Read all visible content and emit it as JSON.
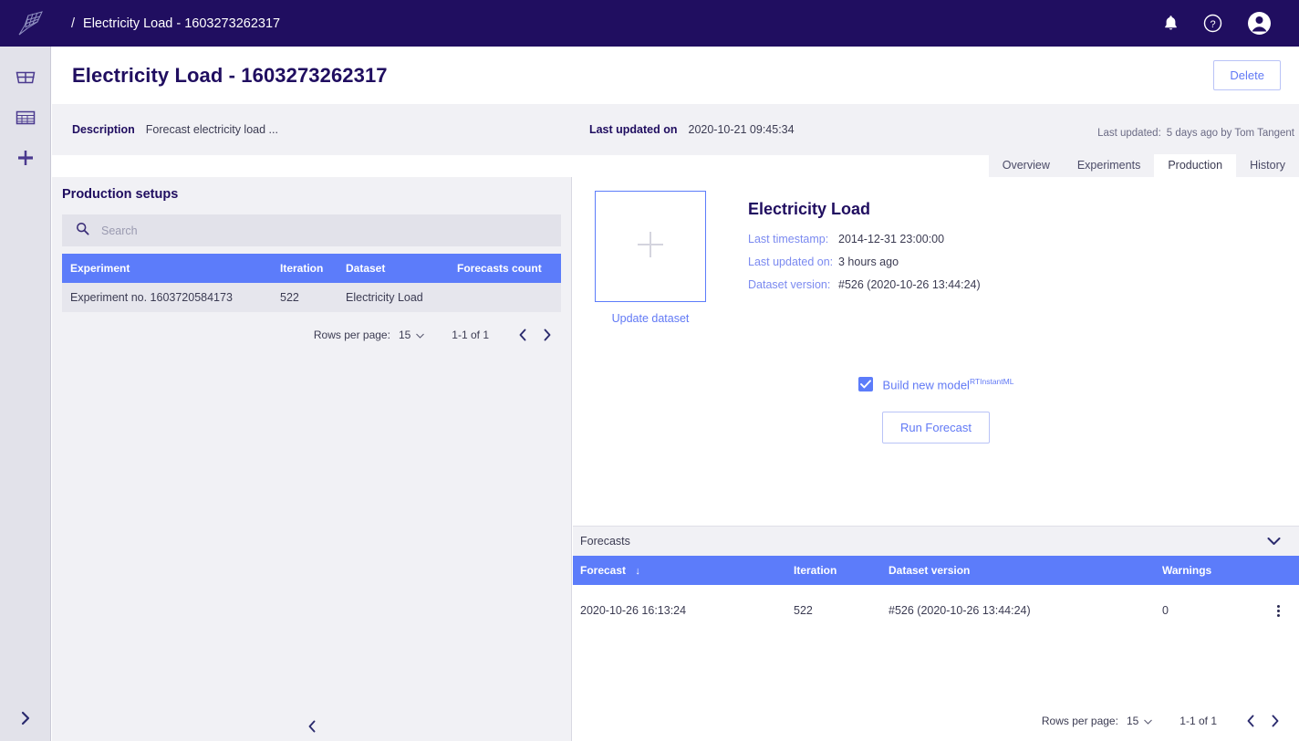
{
  "topbar": {
    "logo_icon": "net-logo-icon",
    "breadcrumb_separator": "/",
    "breadcrumb_title": "Electricity Load - 1603273262317",
    "icons": [
      {
        "name": "notifications-icon",
        "label": "bell"
      },
      {
        "name": "help-icon",
        "label": "question-circle"
      },
      {
        "name": "account-icon",
        "label": "user-avatar"
      }
    ]
  },
  "rail": {
    "items": [
      {
        "name": "dashboard-icon",
        "label": "Dashboard"
      },
      {
        "name": "datasets-table-icon",
        "label": "Datasets"
      },
      {
        "name": "add-new-icon",
        "label": "Add new"
      }
    ],
    "expand_icon": "chevron-right-icon"
  },
  "page": {
    "title": "Electricity Load - 1603273262317",
    "delete_label": "Delete"
  },
  "meta": {
    "description_label": "Description",
    "description_value": "Forecast electricity load ...",
    "last_updated_on_label": "Last updated on",
    "last_updated_on_value": "2020-10-21 09:45:34",
    "last_updated_label": "Last updated:",
    "last_updated_value": "5 days ago by Tom Tangent"
  },
  "tabs": [
    {
      "label": "Overview",
      "active": false
    },
    {
      "label": "Experiments",
      "active": false
    },
    {
      "label": "Production",
      "active": true
    },
    {
      "label": "History",
      "active": false
    }
  ],
  "left_panel": {
    "title": "Production setups",
    "search": {
      "placeholder": "Search",
      "value": "",
      "icon": "search-icon"
    },
    "table": {
      "columns": [
        "Experiment",
        "Iteration",
        "Dataset",
        "Forecasts count"
      ],
      "rows": [
        {
          "experiment": "Experiment no. 1603720584173",
          "iteration": "522",
          "dataset": "Electricity Load",
          "forecasts_count": ""
        }
      ]
    },
    "paginator": {
      "rows_per_page_label": "Rows per page:",
      "rows_per_page_value": "15",
      "range": "1-1 of 1",
      "prev_icon": "chevron-left-icon",
      "next_icon": "chevron-right-icon"
    },
    "collapse_icon": "chevron-left-icon"
  },
  "dataset": {
    "thumb_icon": "plus-icon",
    "update_label": "Update dataset",
    "name": "Electricity Load",
    "fields": [
      {
        "key": "Last timestamp:",
        "value": "2014-12-31 23:00:00"
      },
      {
        "key": "Last updated on:",
        "value": "3 hours ago"
      },
      {
        "key": "Dataset version:",
        "value": "#526 (2020-10-26 13:44:24)"
      }
    ],
    "build_checkbox": {
      "checked": true,
      "label": "Build new model",
      "superscript": "RTInstantML"
    },
    "run_button": "Run Forecast"
  },
  "forecasts": {
    "section_title": "Forecasts",
    "collapse_icon": "chevron-down-icon",
    "columns": [
      "Forecast",
      "Iteration",
      "Dataset version",
      "Warnings"
    ],
    "sort_column": "Forecast",
    "sort_icon": "arrow-down-icon",
    "rows": [
      {
        "forecast": "2020-10-26 16:13:24",
        "iteration": "522",
        "dataset_version": "#526 (2020-10-26 13:44:24)",
        "warnings": "0",
        "menu_icon": "kebab-menu-icon"
      }
    ],
    "paginator": {
      "rows_per_page_label": "Rows per page:",
      "rows_per_page_value": "15",
      "range": "1-1 of 1",
      "prev_icon": "chevron-left-icon",
      "next_icon": "chevron-right-icon"
    }
  },
  "colors": {
    "brand_dark": "#200e60",
    "accent_blue": "#5c7cfa",
    "panel_gray": "#f1f1f5",
    "rail_gray": "#e2e2ea"
  }
}
